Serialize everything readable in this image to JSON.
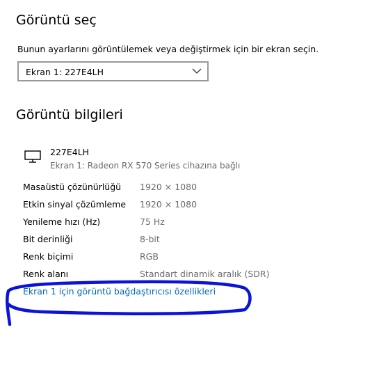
{
  "select_display": {
    "title": "Görüntü seç",
    "instruction": "Bunun ayarlarını görüntülemek veya değiştirmek için bir ekran seçin.",
    "dropdown_value": "Ekran 1: 227E4LH"
  },
  "display_info": {
    "title": "Görüntü bilgileri",
    "monitor_name": "227E4LH",
    "monitor_subtitle": "Ekran 1: Radeon RX 570 Series cihazına bağlı",
    "properties": [
      {
        "label": "Masaüstü çözünürlüğü",
        "value": "1920 × 1080"
      },
      {
        "label": "Etkin sinyal çözümleme",
        "value": "1920 × 1080"
      },
      {
        "label": "Yenileme hızı (Hz)",
        "value": "75 Hz"
      },
      {
        "label": "Bit derinliği",
        "value": "8-bit"
      },
      {
        "label": "Renk biçimi",
        "value": "RGB"
      },
      {
        "label": "Renk alanı",
        "value": "Standart dinamik aralık (SDR)"
      }
    ],
    "adapter_link": "Ekran 1 için görüntü bağdaştırıcısı özellikleri"
  },
  "icons": {
    "monitor": "monitor-icon",
    "dropdown": "chevron-down-icon"
  },
  "colors": {
    "link": "#0067b8",
    "secondary_text": "#6b6b6b",
    "annotation_ink": "#0a14d8"
  }
}
